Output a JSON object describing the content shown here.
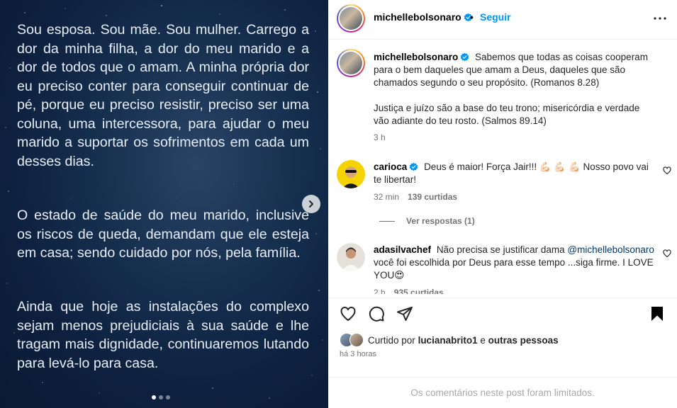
{
  "media": {
    "paragraphs": [
      "Sou esposa. Sou mãe. Sou mulher. Carrego a dor da minha filha, a dor do meu marido e a dor de todos que o amam. A minha própria dor eu preciso conter para conseguir continuar de pé, porque eu preciso resistir, preciso ser uma coluna, uma intercessora, para ajudar o meu marido a suportar os sofrimentos em cada um desses dias.",
      "O estado de saúde do meu marido, inclusive os riscos de queda, demandam que ele esteja em casa; sendo cuidado por nós, pela família.",
      "Ainda que hoje as instalações do complexo sejam menos prejudiciais à sua saúde e lhe tragam mais dignidade, continuaremos lutando para levá-lo para casa."
    ],
    "carousel_position": {
      "current": 1,
      "total": 3
    },
    "next_icon": "chevron-right-icon"
  },
  "header": {
    "username": "michellebolsonaro",
    "separator": "•",
    "follow_label": "Seguir",
    "more_icon": "ellipsis-icon"
  },
  "caption": {
    "username": "michellebolsonaro",
    "text_1": "Sabemos que todas as coisas cooperam para o bem daqueles que amam a Deus, daqueles que são chamados segundo o seu propósito. (Romanos 8.28)",
    "text_2": "Justiça e juízo são a base do teu trono; misericórdia e verdade vão adiante do teu rosto. (Salmos 89.14)",
    "time": "3 h"
  },
  "comments": [
    {
      "username": "carioca",
      "text": "Deus é maior! Força Jair!!! 💪🏻 💪🏻 💪🏻  Nosso povo vai te libertar!",
      "time": "32 min",
      "likes": "139 curtidas",
      "replies_label": "Ver respostas (1)"
    },
    {
      "username": "adasilvachef",
      "text_before": "Não precisa se justificar dama",
      "mention": "@michellebolsonaro",
      "text_after": "você foi escolhida por Deus para esse tempo ...siga firme. I LOVE YOU😍",
      "time": "2 h",
      "likes": "935 curtidas"
    }
  ],
  "actions": {
    "like_icon": "heart-icon",
    "comment_icon": "comment-icon",
    "share_icon": "send-icon",
    "save_icon": "bookmark-icon"
  },
  "likes": {
    "prefix": "Curtido por",
    "user": "lucianabrito1",
    "middle": "e",
    "others": "outras pessoas"
  },
  "post_time": "há 3 horas",
  "comments_limited": "Os comentários neste post foram limitados.",
  "colors": {
    "link_blue": "#0095f6",
    "verified_blue": "#0095f6",
    "media_bg": "#0e2140"
  }
}
